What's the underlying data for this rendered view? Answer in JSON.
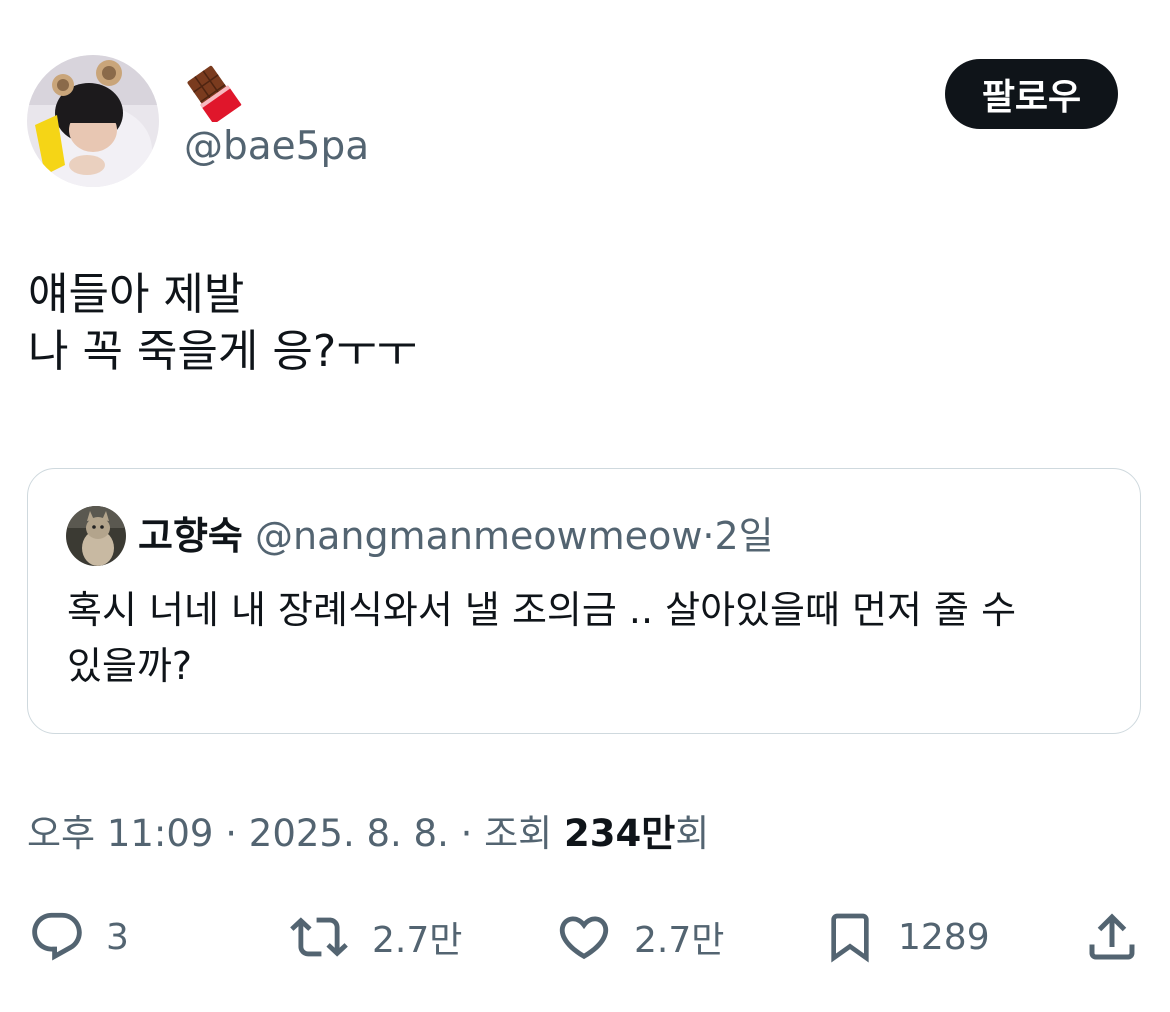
{
  "author": {
    "display_name_emoji": "chocolate-bar-emoji",
    "handle": "@bae5pa",
    "follow_label": "팔로우"
  },
  "tweet": {
    "lines": [
      "얘들아 제발",
      "나 꼭 죽을게 응?ㅜㅜ"
    ]
  },
  "quote": {
    "name": "고향숙",
    "handle": "@nangmanmeowmeow",
    "separator": "·",
    "time": "2일",
    "lines": [
      "혹시 너네 내 장례식와서 낼 조의금 .. 살아있을때 먼저 줄 수",
      "있을까?"
    ]
  },
  "meta": {
    "time": "오후 11:09",
    "sep1": " · ",
    "date": "2025. 8. 8.",
    "sep2": " · ",
    "views_label": "조회 ",
    "views_count": "234만",
    "views_suffix": "회"
  },
  "actions": {
    "reply_count": "3",
    "retweet_count": "2.7만",
    "like_count": "2.7만",
    "bookmark_count": "1289"
  },
  "colors": {
    "text": "#0f1419",
    "secondary": "#536471",
    "border": "#cfd9de",
    "button_bg": "#0f1419"
  }
}
